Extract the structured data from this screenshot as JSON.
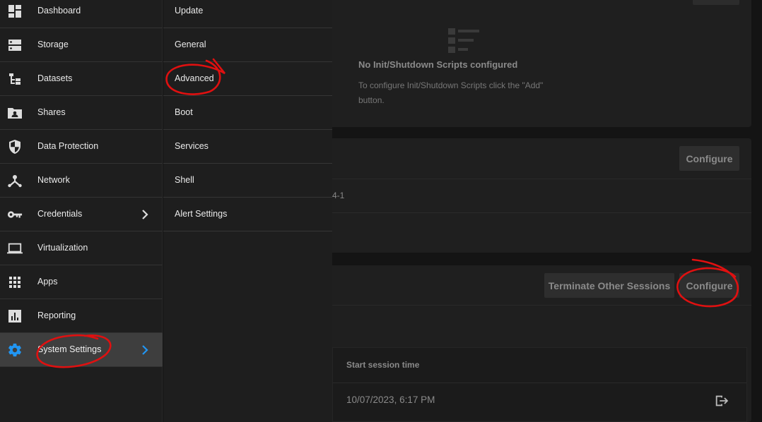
{
  "main": {
    "init_scripts": {
      "empty_title": "No Init/Shutdown Scripts configured",
      "empty_description": "To configure Init/Shutdown Scripts click the \"Add\" button."
    },
    "card_two": {
      "configure_label": "Configure",
      "partial_value": "4-1"
    },
    "sessions": {
      "terminate_label": "Terminate Other Sessions",
      "configure_label": "Configure",
      "column_header": "Start session time",
      "rows": [
        {
          "start_time": "10/07/2023, 6:17 PM"
        }
      ]
    }
  },
  "sidebar": {
    "items": [
      {
        "label": "Dashboard",
        "icon": "dashboard-icon"
      },
      {
        "label": "Storage",
        "icon": "storage-icon"
      },
      {
        "label": "Datasets",
        "icon": "datasets-icon"
      },
      {
        "label": "Shares",
        "icon": "shares-icon"
      },
      {
        "label": "Data Protection",
        "icon": "shield-icon"
      },
      {
        "label": "Network",
        "icon": "network-icon"
      },
      {
        "label": "Credentials",
        "icon": "key-icon"
      },
      {
        "label": "Virtualization",
        "icon": "laptop-icon"
      },
      {
        "label": "Apps",
        "icon": "apps-grid-icon"
      },
      {
        "label": "Reporting",
        "icon": "reporting-icon"
      },
      {
        "label": "System Settings",
        "icon": "gear-icon"
      }
    ]
  },
  "submenu": {
    "items": [
      {
        "label": "Update"
      },
      {
        "label": "General"
      },
      {
        "label": "Advanced"
      },
      {
        "label": "Boot"
      },
      {
        "label": "Services"
      },
      {
        "label": "Shell"
      },
      {
        "label": "Alert Settings"
      }
    ]
  },
  "colors": {
    "accent_blue": "#2196f3",
    "annotation_red": "#e01010"
  }
}
